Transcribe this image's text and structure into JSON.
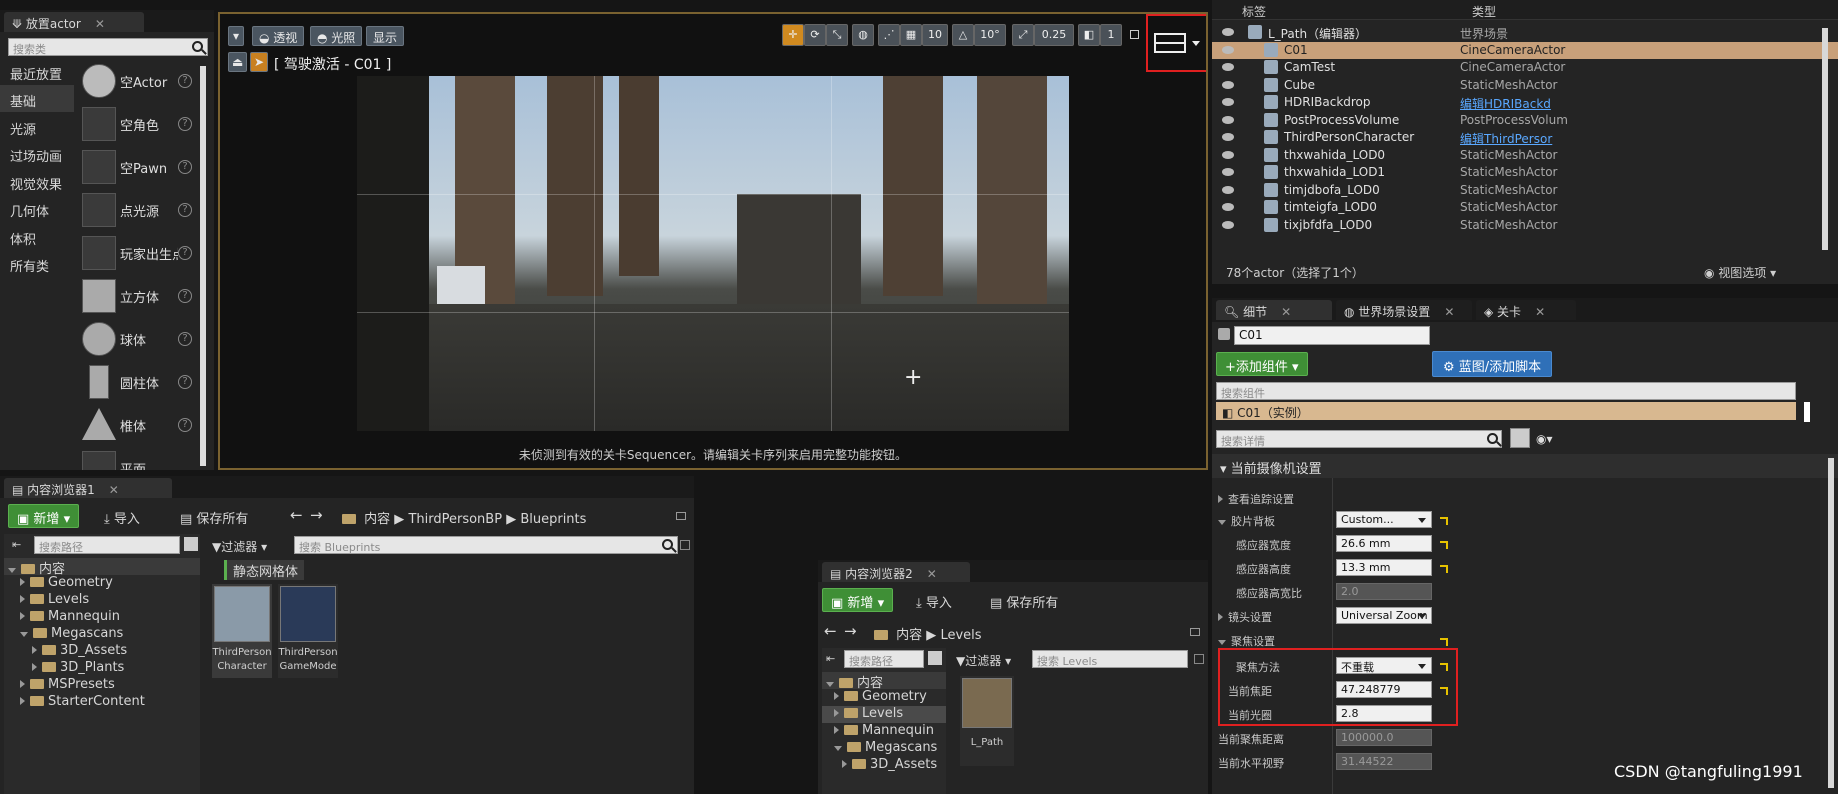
{
  "place_actor": {
    "tab": "放置actor",
    "search_placeholder": "搜索类",
    "categories": [
      "最近放置",
      "基础",
      "光源",
      "过场动画",
      "视觉效果",
      "几何体",
      "体积",
      "所有类"
    ],
    "items": [
      "空Actor",
      "空角色",
      "空Pawn",
      "点光源",
      "玩家出生点",
      "立方体",
      "球体",
      "圆柱体",
      "椎体",
      "平面"
    ]
  },
  "viewport": {
    "buttons": [
      "透视",
      "光照",
      "显示"
    ],
    "pilot_label": "[ 驾驶激活 - C01 ]",
    "grid_snap": "10",
    "rot_snap": "10°",
    "scale_snap": "0.25",
    "cam_speed": "1",
    "message": "未侦测到有效的关卡Sequencer。请编辑关卡序列来启用完整功能按钮。"
  },
  "outliner": {
    "header_label": "标签",
    "header_type": "类型",
    "rows": [
      {
        "name": "L_Path（编辑器）",
        "type": "世界场景",
        "link": false
      },
      {
        "name": "C01",
        "type": "CineCameraActor",
        "link": false
      },
      {
        "name": "CamTest",
        "type": "CineCameraActor",
        "link": false
      },
      {
        "name": "Cube",
        "type": "StaticMeshActor",
        "link": false
      },
      {
        "name": "HDRIBackdrop",
        "type": "编辑HDRIBackd",
        "link": true
      },
      {
        "name": "PostProcessVolume",
        "type": "PostProcessVolum",
        "link": false
      },
      {
        "name": "ThirdPersonCharacter",
        "type": "编辑ThirdPersor",
        "link": true
      },
      {
        "name": "thxwahida_LOD0",
        "type": "StaticMeshActor",
        "link": false
      },
      {
        "name": "thxwahida_LOD1",
        "type": "StaticMeshActor",
        "link": false
      },
      {
        "name": "timjdbofa_LOD0",
        "type": "StaticMeshActor",
        "link": false
      },
      {
        "name": "timteigfa_LOD0",
        "type": "StaticMeshActor",
        "link": false
      },
      {
        "name": "tixjbfdfa_LOD0",
        "type": "StaticMeshActor",
        "link": false
      }
    ],
    "status": "78个actor（选择了1个）",
    "view_options": "视图选项"
  },
  "details": {
    "tabs": [
      "细节",
      "世界场景设置",
      "关卡"
    ],
    "name": "C01",
    "add_component": "+添加组件",
    "blueprint": "蓝图/添加脚本",
    "search_components": "搜索组件",
    "instance": "C01（实例）",
    "search_details": "搜索详情",
    "section": "当前摄像机设置",
    "props": {
      "lookat": "查看追踪设置",
      "filmback": "胶片背板",
      "filmback_val": "Custom...",
      "sensor_w": "感应器宽度",
      "sensor_w_val": "26.6 mm",
      "sensor_h": "感应器高度",
      "sensor_h_val": "13.3 mm",
      "aspect": "感应器高宽比",
      "aspect_val": "2.0",
      "lens": "镜头设置",
      "lens_val": "Universal Zoom",
      "focus": "聚焦设置",
      "focus_method": "聚焦方法",
      "focus_method_val": "不重载",
      "focal_len": "当前焦距",
      "focal_len_val": "47.248779",
      "aperture": "当前光圈",
      "aperture_val": "2.8",
      "focus_dist": "当前聚焦距离",
      "focus_dist_val": "100000.0",
      "h_fov": "当前水平视野",
      "h_fov_val": "31.44522"
    }
  },
  "cb1": {
    "tab": "内容浏览器1",
    "new": "新增",
    "import": "导入",
    "save_all": "保存所有",
    "path": [
      "内容",
      "ThirdPersonBP",
      "Blueprints"
    ],
    "search_path": "搜索路径",
    "filter": "过滤器",
    "search_assets": "搜索 Blueprints",
    "filter_chip": "静态网格体",
    "tree": [
      "内容",
      "Geometry",
      "Levels",
      "Mannequin",
      "Megascans",
      "3D_Assets",
      "3D_Plants",
      "MSPresets",
      "StarterContent"
    ],
    "assets": [
      {
        "l1": "ThirdPerson",
        "l2": "Character"
      },
      {
        "l1": "ThirdPerson",
        "l2": "GameMode"
      }
    ]
  },
  "cb2": {
    "tab": "内容浏览器2",
    "new": "新增",
    "import": "导入",
    "save_all": "保存所有",
    "path": [
      "内容",
      "Levels"
    ],
    "search_path": "搜索路径",
    "filter": "过滤器",
    "search_assets": "搜索 Levels",
    "tree": [
      "内容",
      "Geometry",
      "Levels",
      "Mannequin",
      "Megascans",
      "3D_Assets"
    ],
    "asset": "L_Path"
  },
  "watermark": "CSDN @tangfuling1991"
}
